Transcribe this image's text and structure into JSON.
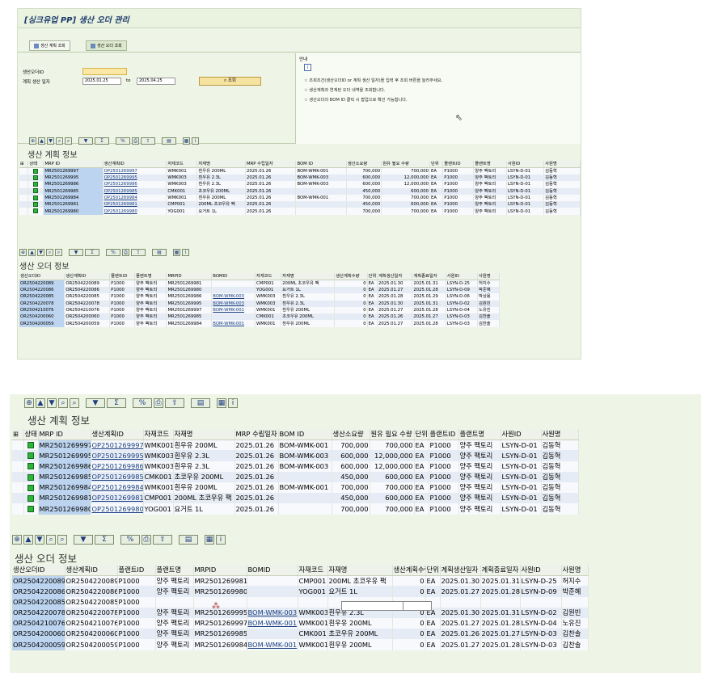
{
  "window": {
    "title": "[싱크유업 PP] 생산 오더 관리"
  },
  "tabs": [
    {
      "label": "생산 계획 조회",
      "active": false
    },
    {
      "label": "생산 오더 조회",
      "active": true
    }
  ],
  "query": {
    "order_id_label": "생산오더ID",
    "order_id_value": "",
    "date_label": "계획 생산 일자",
    "date_from": "2025.01.25",
    "to_label": "to",
    "date_to": "2025.04.25",
    "search_button": "조회"
  },
  "info": {
    "title": "안내",
    "icon": "i",
    "lines": [
      "☆ 조회조건(생산오더ID or 계획 생산 일자)을 입력 후 조회 버튼을 눌러주세요.",
      "☆ 생산계획과 연계된 오더 내역을 조회합니다.",
      "☆ 생산오더의 BOM ID 클릭 시 팝업으로 확인 가능합니다."
    ]
  },
  "toolbar_icons": [
    "details-icon",
    "sort-asc-icon",
    "sort-desc-icon",
    "find-icon",
    "find-next-icon",
    "filter-icon",
    "sum-icon",
    "subtotal-icon",
    "print-icon",
    "export-icon",
    "layout-icon",
    "grid-icon",
    "info-icon"
  ],
  "toolbar_glyphs": [
    "⊕",
    "▲",
    "▼",
    "⌕",
    "⌕",
    "▼",
    "Σ",
    "%",
    "⎙",
    "⇪",
    "▤",
    "▦",
    "i"
  ],
  "plan_section": {
    "title": "생산 계획 정보",
    "columns": [
      "상태",
      "MRP ID",
      "생산계획ID",
      "자재코드",
      "자재명",
      "MRP 수립일자",
      "BOM ID",
      "생산소요량",
      "원유 필요 수량",
      "단위",
      "플랜트ID",
      "플랜트명",
      "사원ID",
      "사원명"
    ],
    "rows": [
      {
        "mrp_id": "MR2501269997",
        "plan_id": "OP2501269997",
        "mat_code": "WMK001",
        "mat_name": "흰우유 200ML",
        "mrp_date": "2025.01.26",
        "bom_id": "BOM-WMK-001",
        "req_qty": "700,000",
        "milk_qty": "700,000",
        "unit": "EA",
        "plant_id": "P1000",
        "plant_name": "양주 팩토리",
        "emp_id": "LSYN-D-01",
        "emp_name": "김동혁"
      },
      {
        "mrp_id": "MR2501269995",
        "plan_id": "OP2501269995",
        "mat_code": "WMK003",
        "mat_name": "흰우유 2.3L",
        "mrp_date": "2025.01.26",
        "bom_id": "BOM-WMK-003",
        "req_qty": "600,000",
        "milk_qty": "12,000,000",
        "unit": "EA",
        "plant_id": "P1000",
        "plant_name": "양주 팩토리",
        "emp_id": "LSYN-D-01",
        "emp_name": "김동혁"
      },
      {
        "mrp_id": "MR2501269986",
        "plan_id": "OP2501269986",
        "mat_code": "WMK003",
        "mat_name": "흰우유 2.3L",
        "mrp_date": "2025.01.26",
        "bom_id": "BOM-WMK-003",
        "req_qty": "600,000",
        "milk_qty": "12,000,000",
        "unit": "EA",
        "plant_id": "P1000",
        "plant_name": "양주 팩토리",
        "emp_id": "LSYN-D-01",
        "emp_name": "김동혁"
      },
      {
        "mrp_id": "MR2501269985",
        "plan_id": "OP2501269985",
        "mat_code": "CMK001",
        "mat_name": "초코우유 200ML",
        "mrp_date": "2025.01.26",
        "bom_id": "",
        "req_qty": "450,000",
        "milk_qty": "600,000",
        "unit": "EA",
        "plant_id": "P1000",
        "plant_name": "양주 팩토리",
        "emp_id": "LSYN-D-01",
        "emp_name": "김동혁"
      },
      {
        "mrp_id": "MR2501269984",
        "plan_id": "OP2501269984",
        "mat_code": "WMK001",
        "mat_name": "흰우유 200ML",
        "mrp_date": "2025.01.26",
        "bom_id": "BOM-WMK-001",
        "req_qty": "700,000",
        "milk_qty": "700,000",
        "unit": "EA",
        "plant_id": "P1000",
        "plant_name": "양주 팩토리",
        "emp_id": "LSYN-D-01",
        "emp_name": "김동혁"
      },
      {
        "mrp_id": "MR2501269981",
        "plan_id": "OP2501269981",
        "mat_code": "CMP001",
        "mat_name": "200ML 초코우유 팩",
        "mrp_date": "2025.01.26",
        "bom_id": "",
        "req_qty": "450,000",
        "milk_qty": "600,000",
        "unit": "EA",
        "plant_id": "P1000",
        "plant_name": "양주 팩토리",
        "emp_id": "LSYN-D-01",
        "emp_name": "김동혁"
      },
      {
        "mrp_id": "MR2501269980",
        "plan_id": "OP2501269980",
        "mat_code": "YOG001",
        "mat_name": "요거트 1L",
        "mrp_date": "2025.01.26",
        "bom_id": "",
        "req_qty": "700,000",
        "milk_qty": "700,000",
        "unit": "EA",
        "plant_id": "P1000",
        "plant_name": "양주 팩토리",
        "emp_id": "LSYN-D-01",
        "emp_name": "김동혁"
      }
    ]
  },
  "order_section": {
    "title": "생산 오더 정보",
    "columns": [
      "생산오더ID",
      "생산계획ID",
      "플랜트ID",
      "플랜트명",
      "MRPID",
      "BOMID",
      "자재코드",
      "자재명",
      "생산계획수량",
      "단위",
      "계획생산일자",
      "계획종료일자",
      "사원ID",
      "사원명"
    ],
    "rows": [
      {
        "order_id": "OR2504220089",
        "plan_id": "OR2504220089",
        "plant_id": "P1000",
        "plant_name": "양주 팩토리",
        "mrp_id": "MR2501269981",
        "bom_id": "",
        "mat_code": "CMP001",
        "mat_name": "200ML 초코우유 팩",
        "qty": "0",
        "unit": "EA",
        "start": "2025.01.30",
        "end": "2025.01.31",
        "emp_id": "LSYN-D-25",
        "emp_name": "허지수"
      },
      {
        "order_id": "OR2504220086",
        "plan_id": "OR2504220086",
        "plant_id": "P1000",
        "plant_name": "양주 팩토리",
        "mrp_id": "MR2501269980",
        "bom_id": "",
        "mat_code": "YOG001",
        "mat_name": "요거트 1L",
        "qty": "0",
        "unit": "EA",
        "start": "2025.01.27",
        "end": "2025.01.28",
        "emp_id": "LSYN-D-09",
        "emp_name": "박준혜"
      },
      {
        "order_id": "OR2504220085",
        "plan_id": "OR2504220085",
        "plant_id": "P1000",
        "plant_name": "양주 팩토리",
        "mrp_id": "MR2501269986",
        "bom_id": "BOM-WMK-003",
        "mat_code": "WMK003",
        "mat_name": "흰우유 2.3L",
        "qty": "0",
        "unit": "EA",
        "start": "2025.01.28",
        "end": "2025.01.29",
        "emp_id": "LSYN-D-06",
        "emp_name": "박상용"
      },
      {
        "order_id": "OR2504220078",
        "plan_id": "OR2504220078",
        "plant_id": "P1000",
        "plant_name": "양주 팩토리",
        "mrp_id": "MR2501269995",
        "bom_id": "BOM-WMK-003",
        "mat_code": "WMK003",
        "mat_name": "흰우유 2.3L",
        "qty": "0",
        "unit": "EA",
        "start": "2025.01.30",
        "end": "2025.01.31",
        "emp_id": "LSYN-D-02",
        "emp_name": "김원빈"
      },
      {
        "order_id": "OR2504210076",
        "plan_id": "OR2504210076",
        "plant_id": "P1000",
        "plant_name": "양주 팩토리",
        "mrp_id": "MR2501269997",
        "bom_id": "BOM-WMK-001",
        "mat_code": "WMK001",
        "mat_name": "흰우유 200ML",
        "qty": "0",
        "unit": "EA",
        "start": "2025.01.27",
        "end": "2025.01.28",
        "emp_id": "LSYN-D-04",
        "emp_name": "노유진"
      },
      {
        "order_id": "OR2504200060",
        "plan_id": "OR2504200060",
        "plant_id": "P1000",
        "plant_name": "양주 팩토리",
        "mrp_id": "MR2501269985",
        "bom_id": "",
        "mat_code": "CMK001",
        "mat_name": "초코우유 200ML",
        "qty": "0",
        "unit": "EA",
        "start": "2025.01.26",
        "end": "2025.01.27",
        "emp_id": "LSYN-D-03",
        "emp_name": "김찬솔"
      },
      {
        "order_id": "OR2504200059",
        "plan_id": "OR2504200059",
        "plant_id": "P1000",
        "plant_name": "양주 팩토리",
        "mrp_id": "MR2501269984",
        "bom_id": "BOM-WMK-001",
        "mat_code": "WMK001",
        "mat_name": "흰우유 200ML",
        "qty": "0",
        "unit": "EA",
        "start": "2025.01.27",
        "end": "2025.01.28",
        "emp_id": "LSYN-D-03",
        "emp_name": "김찬솔"
      }
    ]
  },
  "bottom_orders": {
    "rows": [
      {
        "order_id": "OR2504220089",
        "plan_id": "OR2504220089",
        "plant_id": "P1000",
        "plant_name": "양주 팩토리",
        "mrp_id": "MR2501269981",
        "bom_id": "",
        "mat_code": "CMP001",
        "mat_name": "200ML 초코우유 팩",
        "qty": "0",
        "unit": "EA",
        "start": "2025.01.30",
        "end": "2025.01.31",
        "emp_id": "LSYN-D-25",
        "emp_name": "허지수"
      },
      {
        "order_id": "OR2504220086",
        "plan_id": "OR2504220086",
        "plant_id": "P1000",
        "plant_name": "양주 팩토리",
        "mrp_id": "MR2501269980",
        "bom_id": "",
        "mat_code": "YOG001",
        "mat_name": "요거트 1L",
        "qty": "0",
        "unit": "EA",
        "start": "2025.01.27",
        "end": "2025.01.28",
        "emp_id": "LSYN-D-09",
        "emp_name": "박준혜"
      },
      {
        "order_id": "OR2504220085",
        "plan_id": "OR2504220085",
        "plant_id": "P1000",
        "plant_name": "",
        "mrp_id": "",
        "bom_id": "",
        "mat_code": "",
        "mat_name": "",
        "qty": "",
        "unit": "",
        "start": "",
        "end": "",
        "emp_id": "",
        "emp_name": ""
      },
      {
        "order_id": "OR2504220078",
        "plan_id": "OR2504220078",
        "plant_id": "P1000",
        "plant_name": "양주 팩토리",
        "mrp_id": "MR2501269995",
        "bom_id": "BOM-WMK-003",
        "mat_code": "WMK003",
        "mat_name": "흰우유 2.3L",
        "qty": "0",
        "unit": "EA",
        "start": "2025.01.30",
        "end": "2025.01.31",
        "emp_id": "LSYN-D-02",
        "emp_name": "김원빈"
      },
      {
        "order_id": "OR2504210076",
        "plan_id": "OR2504210076",
        "plant_id": "P1000",
        "plant_name": "양주 팩토리",
        "mrp_id": "MR2501269997",
        "bom_id": "BOM-WMK-001",
        "mat_code": "WMK001",
        "mat_name": "흰우유 200ML",
        "qty": "0",
        "unit": "EA",
        "start": "2025.01.27",
        "end": "2025.01.28",
        "emp_id": "LSYN-D-04",
        "emp_name": "노유진"
      },
      {
        "order_id": "OR2504200060",
        "plan_id": "OR2504200060",
        "plant_id": "P1000",
        "plant_name": "양주 팩토리",
        "mrp_id": "MR2501269985",
        "bom_id": "",
        "mat_code": "CMK001",
        "mat_name": "초코우유 200ML",
        "qty": "0",
        "unit": "EA",
        "start": "2025.01.26",
        "end": "2025.01.27",
        "emp_id": "LSYN-D-03",
        "emp_name": "김찬솔"
      },
      {
        "order_id": "OR2504200059",
        "plan_id": "OR2504200059",
        "plant_id": "P1000",
        "plant_name": "양주 팩토리",
        "mrp_id": "MR2501269984",
        "bom_id": "BOM-WMK-001",
        "mat_code": "WMK001",
        "mat_name": "흰우유 200ML",
        "qty": "0",
        "unit": "EA",
        "start": "2025.01.27",
        "end": "2025.01.28",
        "emp_id": "LSYN-D-03",
        "emp_name": "김찬솔"
      }
    ]
  },
  "colors": {
    "frame": "#eef4e6",
    "row_alt": "#e6ecf5",
    "selected": "#bcd4ef",
    "status_green": "#2fb33b",
    "required": "#fbe7a6"
  }
}
